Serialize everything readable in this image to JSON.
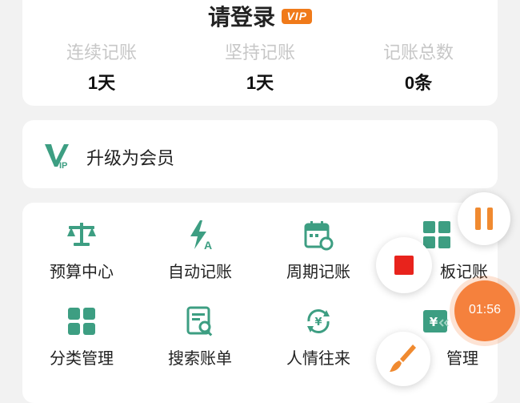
{
  "profile": {
    "login_text": "请登录",
    "vip_badge": "VIP",
    "stats": [
      {
        "label": "连续记账",
        "value": "1天"
      },
      {
        "label": "坚持记账",
        "value": "1天"
      },
      {
        "label": "记账总数",
        "value": "0条"
      }
    ]
  },
  "upgrade": {
    "icon": "vip-logo-icon",
    "label": "升级为会员"
  },
  "features": [
    {
      "label": "预算中心",
      "icon": "scale-icon"
    },
    {
      "label": "自动记账",
      "icon": "lightning-a-icon"
    },
    {
      "label": "周期记账",
      "icon": "calendar-repeat-icon"
    },
    {
      "label": "板记账",
      "icon": "grid-tiles-icon"
    },
    {
      "label": "分类管理",
      "icon": "category-grid-icon"
    },
    {
      "label": "搜索账单",
      "icon": "bill-search-icon"
    },
    {
      "label": "人情往来",
      "icon": "yen-cycle-icon"
    },
    {
      "label": "管理",
      "icon": "yen-card-icon"
    }
  ],
  "recorder": {
    "timer": "01:56",
    "pause_icon": "pause-icon",
    "stop_icon": "stop-icon",
    "brush_icon": "brush-icon"
  },
  "colors": {
    "accent_green": "#3d9e82",
    "vip_orange": "#f07a1a",
    "recorder_orange": "#f5813d",
    "stop_red": "#e8231c"
  }
}
